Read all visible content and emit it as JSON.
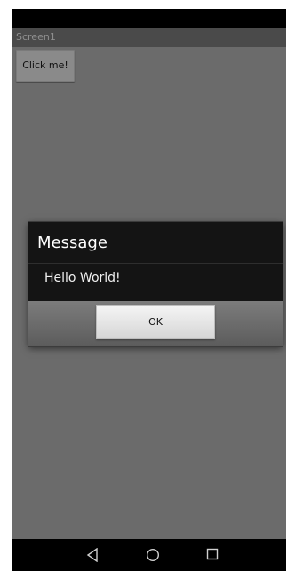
{
  "screen": {
    "title": "Screen1"
  },
  "main": {
    "click_button_label": "Click me!"
  },
  "dialog": {
    "title": "Message",
    "message": "Hello World!",
    "ok_label": "OK"
  },
  "navigation": {
    "back_icon": "back-triangle-icon",
    "home_icon": "home-circle-icon",
    "recent_icon": "recent-apps-square-icon"
  }
}
